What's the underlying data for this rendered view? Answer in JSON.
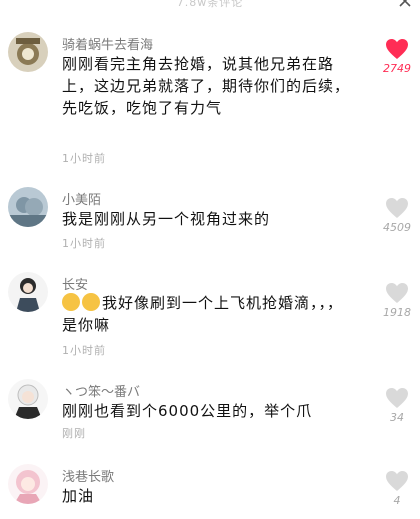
{
  "header": {
    "title": "7.8w条评论"
  },
  "comments": [
    {
      "author": "骑着蜗牛去看海",
      "text": "刚刚看完主角去抢婚，说其他兄弟在路上，这边兄弟就落了，期待你们的后续，先吃饭，吃饱了有力气",
      "time": "1小时前",
      "likes": "2749",
      "liked": true,
      "avatar": "avatar-1"
    },
    {
      "author": "小美陌",
      "text": "我是刚刚从另一个视角过来的",
      "time": "1小时前",
      "likes": "4509",
      "liked": false,
      "avatar": "avatar-2"
    },
    {
      "author": "长安",
      "text": "我好像刷到一个上飞机抢婚滴，，，是你嘛",
      "time": "1小时前",
      "likes": "1918",
      "liked": false,
      "avatar": "avatar-3"
    },
    {
      "author": "ヽつ笨～番バ",
      "text": "刚刚也看到个6000公里的，举个爪",
      "time": "刚刚",
      "likes": "34",
      "liked": false,
      "avatar": "avatar-4"
    },
    {
      "author": "浅巷长歌",
      "text": "加油",
      "time": "",
      "likes": "4",
      "liked": false,
      "avatar": "avatar-5"
    }
  ],
  "colors": {
    "liked": "#ff2d55",
    "unliked": "#d9d9d9"
  }
}
